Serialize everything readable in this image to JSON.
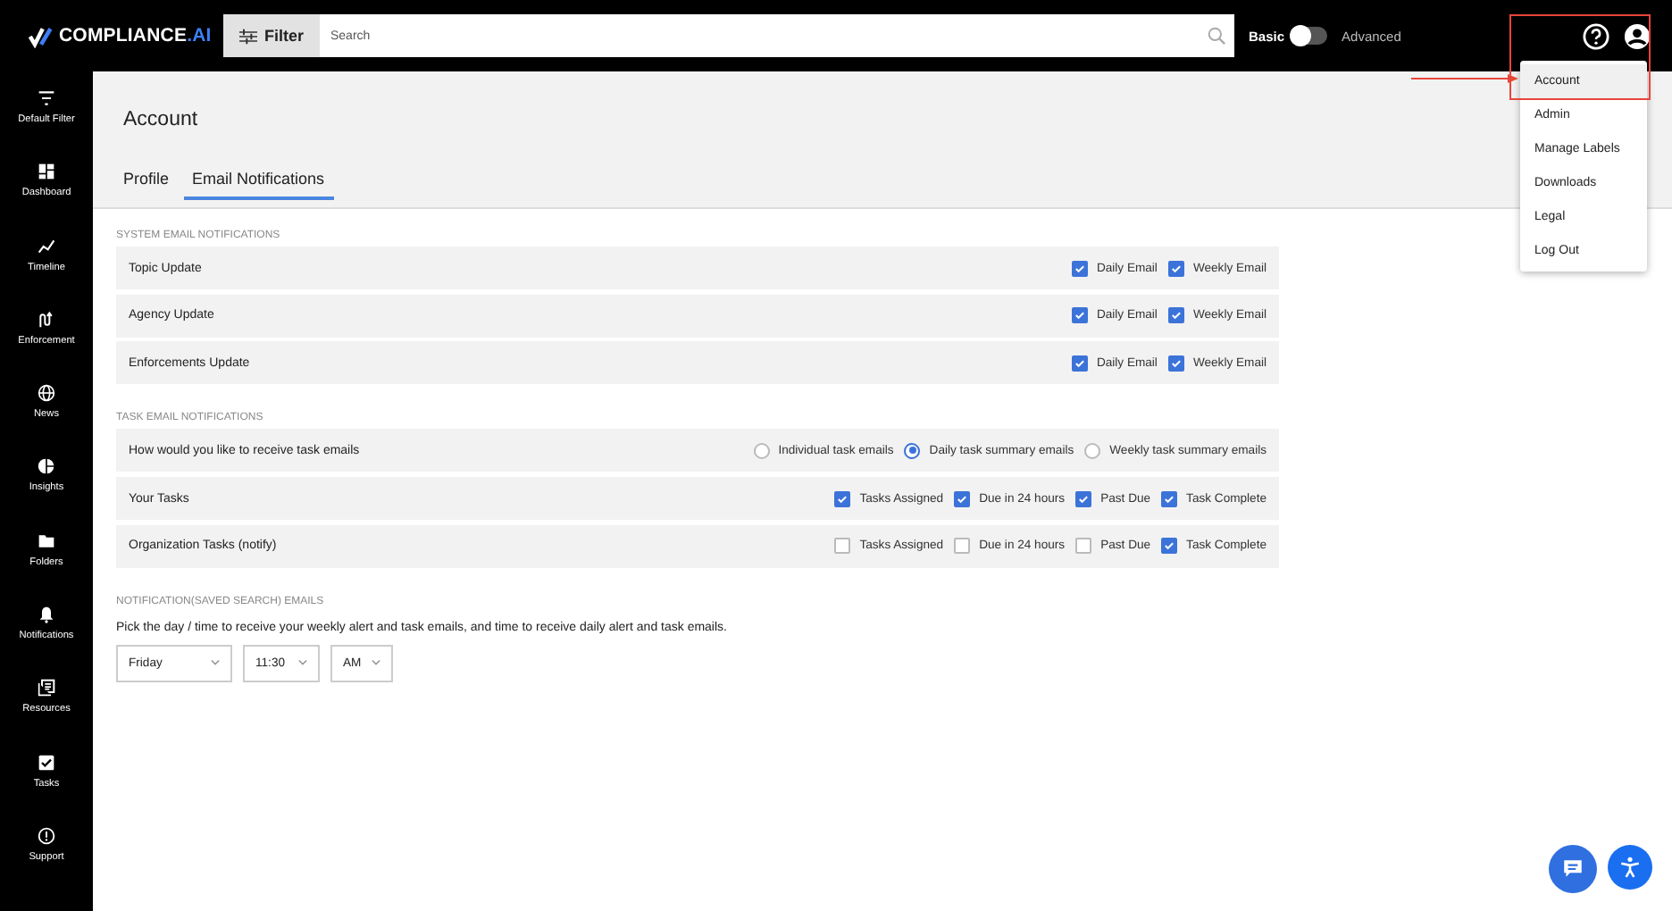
{
  "topbar": {
    "logo": {
      "name": "COMPLIANCE",
      "suffix": ".AI"
    },
    "filter_button": "Filter",
    "search": {
      "placeholder": "Search"
    },
    "mode_toggle": {
      "left_label": "Basic",
      "right_label": "Advanced",
      "on": false
    }
  },
  "user_menu": {
    "items": [
      {
        "label": "Account",
        "selected": true
      },
      {
        "label": "Admin",
        "selected": false
      },
      {
        "label": "Manage Labels",
        "selected": false
      },
      {
        "label": "Downloads",
        "selected": false
      },
      {
        "label": "Legal",
        "selected": false
      },
      {
        "label": "Log Out",
        "selected": false
      }
    ]
  },
  "sidebar": {
    "items": [
      {
        "label": "Default Filter",
        "kind": "filter"
      },
      {
        "label": "Dashboard",
        "kind": "dashboard"
      },
      {
        "label": "Timeline",
        "kind": "timeline"
      },
      {
        "label": "Enforcement",
        "kind": "enforcement"
      },
      {
        "label": "News",
        "kind": "news"
      },
      {
        "label": "Insights",
        "kind": "insights"
      },
      {
        "label": "Folders",
        "kind": "folders"
      },
      {
        "label": "Notifications",
        "kind": "notifications"
      },
      {
        "label": "Resources",
        "kind": "resources"
      },
      {
        "label": "Tasks",
        "kind": "tasks"
      },
      {
        "label": "Support",
        "kind": "support"
      }
    ]
  },
  "page": {
    "title": "Account",
    "tabs": [
      {
        "label": "Profile",
        "selected": false
      },
      {
        "label": "Email Notifications",
        "selected": true
      }
    ]
  },
  "sections": [
    {
      "title": "SYSTEM EMAIL NOTIFICATIONS",
      "rows": [
        {
          "label": "Topic Update",
          "kind": "checkboxes",
          "options": [
            {
              "label": "Daily Email",
              "checked": true
            },
            {
              "label": "Weekly Email",
              "checked": true
            }
          ]
        },
        {
          "label": "Agency Update",
          "kind": "checkboxes",
          "options": [
            {
              "label": "Daily Email",
              "checked": true
            },
            {
              "label": "Weekly Email",
              "checked": true
            }
          ]
        },
        {
          "label": "Enforcements Update",
          "kind": "checkboxes",
          "options": [
            {
              "label": "Daily Email",
              "checked": true
            },
            {
              "label": "Weekly Email",
              "checked": true
            }
          ]
        }
      ]
    },
    {
      "title": "TASK EMAIL NOTIFICATIONS",
      "rows": [
        {
          "label": "How would you like to receive task emails",
          "kind": "radios",
          "options": [
            {
              "label": "Individual task emails",
              "selected": false
            },
            {
              "label": "Daily task summary emails",
              "selected": true
            },
            {
              "label": "Weekly task summary emails",
              "selected": false
            }
          ]
        },
        {
          "label": "Your Tasks",
          "kind": "checkboxes",
          "options": [
            {
              "label": "Tasks Assigned",
              "checked": true
            },
            {
              "label": "Due in 24 hours",
              "checked": true
            },
            {
              "label": "Past Due",
              "checked": true
            },
            {
              "label": "Task Complete",
              "checked": true
            }
          ]
        },
        {
          "label": "Organization Tasks (notify)",
          "kind": "checkboxes",
          "options": [
            {
              "label": "Tasks Assigned",
              "checked": false
            },
            {
              "label": "Due in 24 hours",
              "checked": false
            },
            {
              "label": "Past Due",
              "checked": false
            },
            {
              "label": "Task Complete",
              "checked": true
            }
          ]
        }
      ]
    }
  ],
  "saved_search": {
    "title": "NOTIFICATION(SAVED SEARCH) EMAILS",
    "description": "Pick the day / time to receive your weekly alert and task emails, and time to receive daily alert and task emails.",
    "dropdowns": [
      {
        "value": "Friday"
      },
      {
        "value": "11:30"
      },
      {
        "value": "AM"
      }
    ]
  }
}
